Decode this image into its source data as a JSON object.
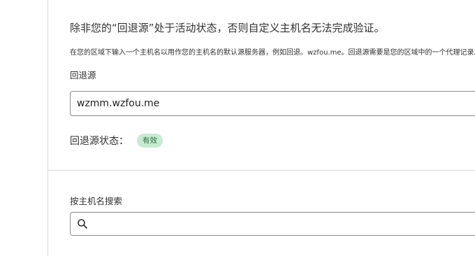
{
  "fallback_origin": {
    "heading": "除非您的“回退源”处于活动状态，否则自定义主机名无法完成验证。",
    "help_text": "在您的区域下输入一个主机名以用作您的主机名的默认源服务器，例如回退。wzfou.me。回退源需要是您的区域中的一个代理记录。",
    "field_label": "回退源",
    "field_value": "wzmm.wzfou.me",
    "status_label": "回退源状态：",
    "status_badge": "有效",
    "status_color": "#c7ebd1"
  },
  "search": {
    "label": "按主机名搜索",
    "placeholder": "",
    "icon": "search-icon"
  }
}
